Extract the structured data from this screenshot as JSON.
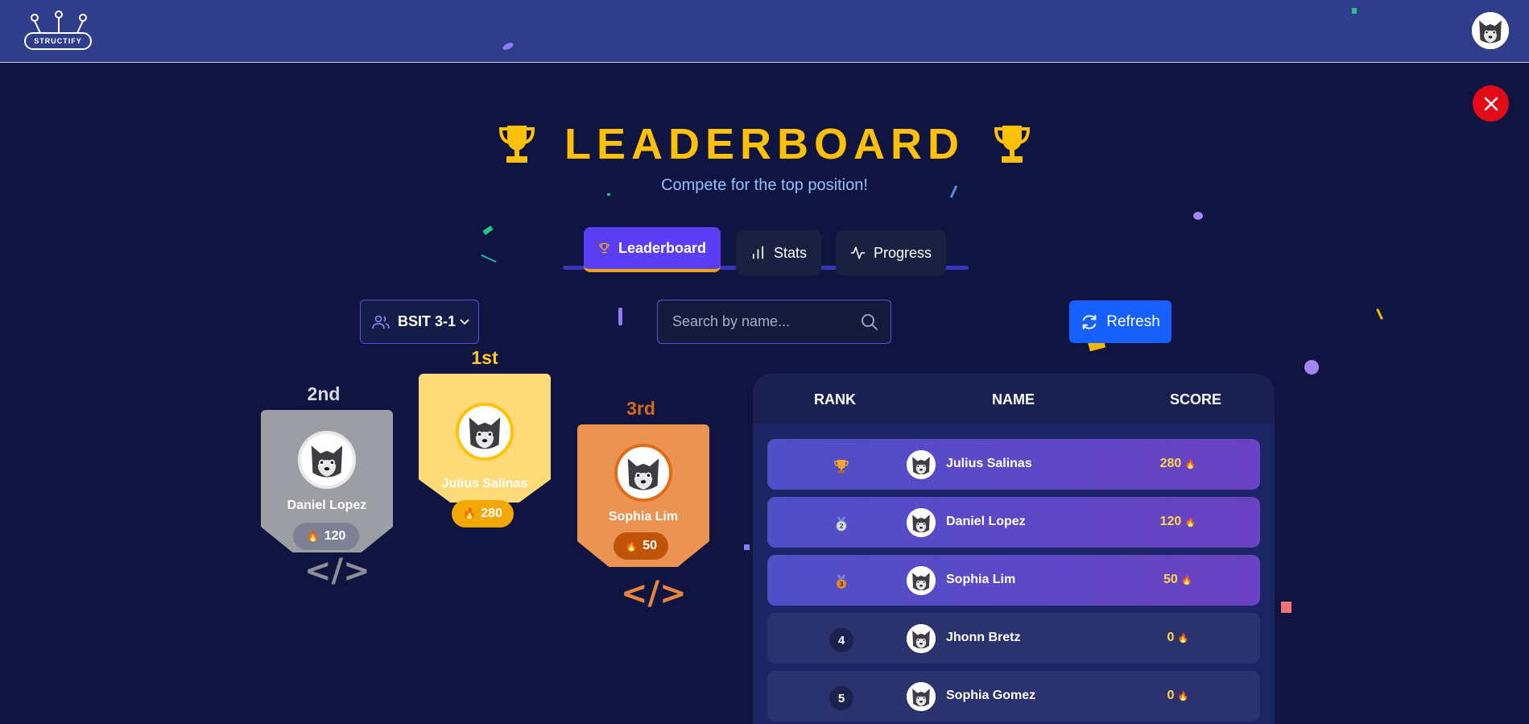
{
  "header": {
    "logo_text": "STRUCTIFY"
  },
  "page": {
    "title": "LEADERBOARD",
    "subtitle": "Compete for the top position!"
  },
  "tabs": [
    {
      "label": "Leaderboard",
      "icon": "trophy-icon",
      "active": true
    },
    {
      "label": "Stats",
      "icon": "bar-chart-icon",
      "active": false
    },
    {
      "label": "Progress",
      "icon": "activity-icon",
      "active": false
    }
  ],
  "filters": {
    "class_value": "BSIT 3-1",
    "search_placeholder": "Search by name...",
    "refresh_label": "Refresh"
  },
  "podium": {
    "first": {
      "place": "1st",
      "name": "Julius Salinas",
      "score": "280"
    },
    "second": {
      "place": "2nd",
      "name": "Daniel Lopez",
      "score": "120"
    },
    "third": {
      "place": "3rd",
      "name": "Sophia Lim",
      "score": "50"
    }
  },
  "table": {
    "headers": {
      "rank": "RANK",
      "name": "NAME",
      "score": "SCORE"
    },
    "rows": [
      {
        "rank": "1",
        "name": "Julius Salinas",
        "score": "280"
      },
      {
        "rank": "2",
        "name": "Daniel Lopez",
        "score": "120"
      },
      {
        "rank": "3",
        "name": "Sophia Lim",
        "score": "50"
      },
      {
        "rank": "4",
        "name": "Jhonn Bretz",
        "score": "0"
      },
      {
        "rank": "5",
        "name": "Sophia Gomez",
        "score": "0"
      }
    ]
  },
  "colors": {
    "background": "#0f1440",
    "topbar": "#2f3d8a",
    "gold": "#ffc107",
    "accent": "#5b3df5",
    "refresh": "#1760ff",
    "close": "#e30b16",
    "silver": "#9c9ea4",
    "bronze": "#eb9352"
  }
}
